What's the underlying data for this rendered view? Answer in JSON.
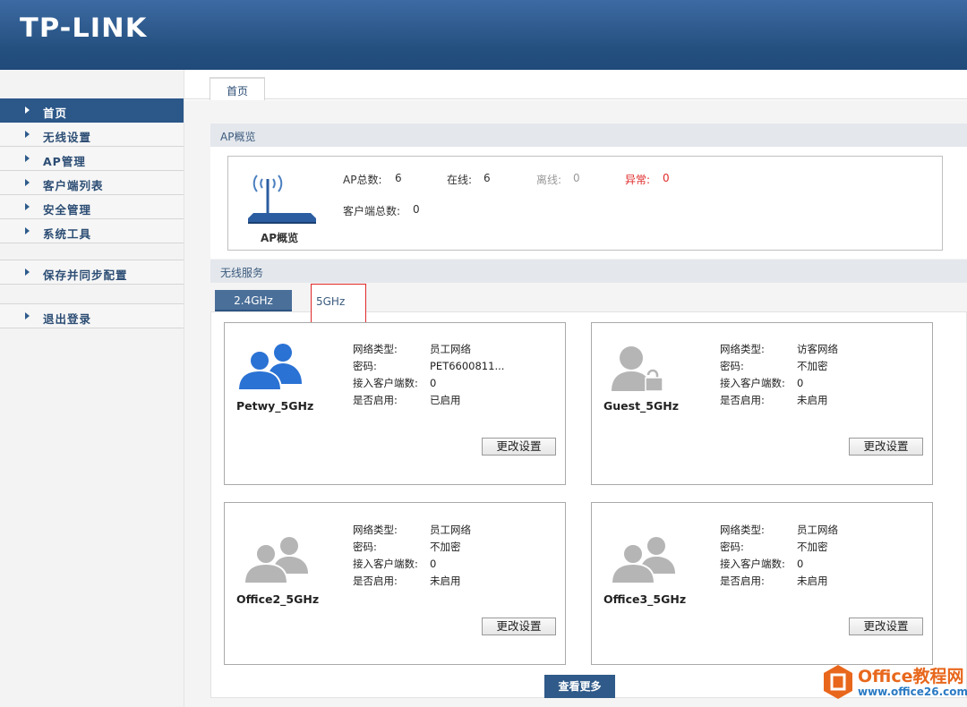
{
  "header": {
    "logo": "TP-LINK"
  },
  "sidebar": {
    "items": [
      {
        "label": "首页",
        "active": true
      },
      {
        "label": "无线设置",
        "active": false
      },
      {
        "label": "AP管理",
        "active": false
      },
      {
        "label": "客户端列表",
        "active": false
      },
      {
        "label": "安全管理",
        "active": false
      },
      {
        "label": "系统工具",
        "active": false
      },
      {
        "label": "保存并同步配置",
        "active": false
      },
      {
        "label": "退出登录",
        "active": false
      }
    ]
  },
  "tabs": {
    "home": "首页"
  },
  "ap_overview": {
    "section_title": "AP概览",
    "icon_label": "AP概览",
    "total_label": "AP总数:",
    "total_value": "6",
    "online_label": "在线:",
    "online_value": "6",
    "offline_label": "离线:",
    "offline_value": "0",
    "abnormal_label": "异常:",
    "abnormal_value": "0",
    "clients_label": "客户端总数:",
    "clients_value": "0"
  },
  "wireless": {
    "section_title": "无线服务",
    "band_tabs": [
      "2.4GHz",
      "5GHz"
    ],
    "labels": {
      "type": "网络类型:",
      "password": "密码:",
      "clients": "接入客户端数:",
      "enabled": "是否启用:"
    },
    "button_label": "更改设置",
    "cards": [
      {
        "ssid": "Petwy_5GHz",
        "type": "员工网络",
        "password": "PET6600811...",
        "clients": "0",
        "enabled": "已启用",
        "icon": "users-blue-icon"
      },
      {
        "ssid": "Guest_5GHz",
        "type": "访客网络",
        "password": "不加密",
        "clients": "0",
        "enabled": "未启用",
        "icon": "guest-user-icon"
      },
      {
        "ssid": "Office2_5GHz",
        "type": "员工网络",
        "password": "不加密",
        "clients": "0",
        "enabled": "未启用",
        "icon": "users-gray-icon"
      },
      {
        "ssid": "Office3_5GHz",
        "type": "员工网络",
        "password": "不加密",
        "clients": "0",
        "enabled": "未启用",
        "icon": "users-gray-icon"
      }
    ],
    "more_button": "查看更多"
  },
  "colors": {
    "header": "#24507f",
    "accent": "#2b5789",
    "abnormal": "#e02a2a",
    "offline": "#999999"
  },
  "watermark": {
    "title": "Office教程网",
    "url": "www.office26.com"
  }
}
